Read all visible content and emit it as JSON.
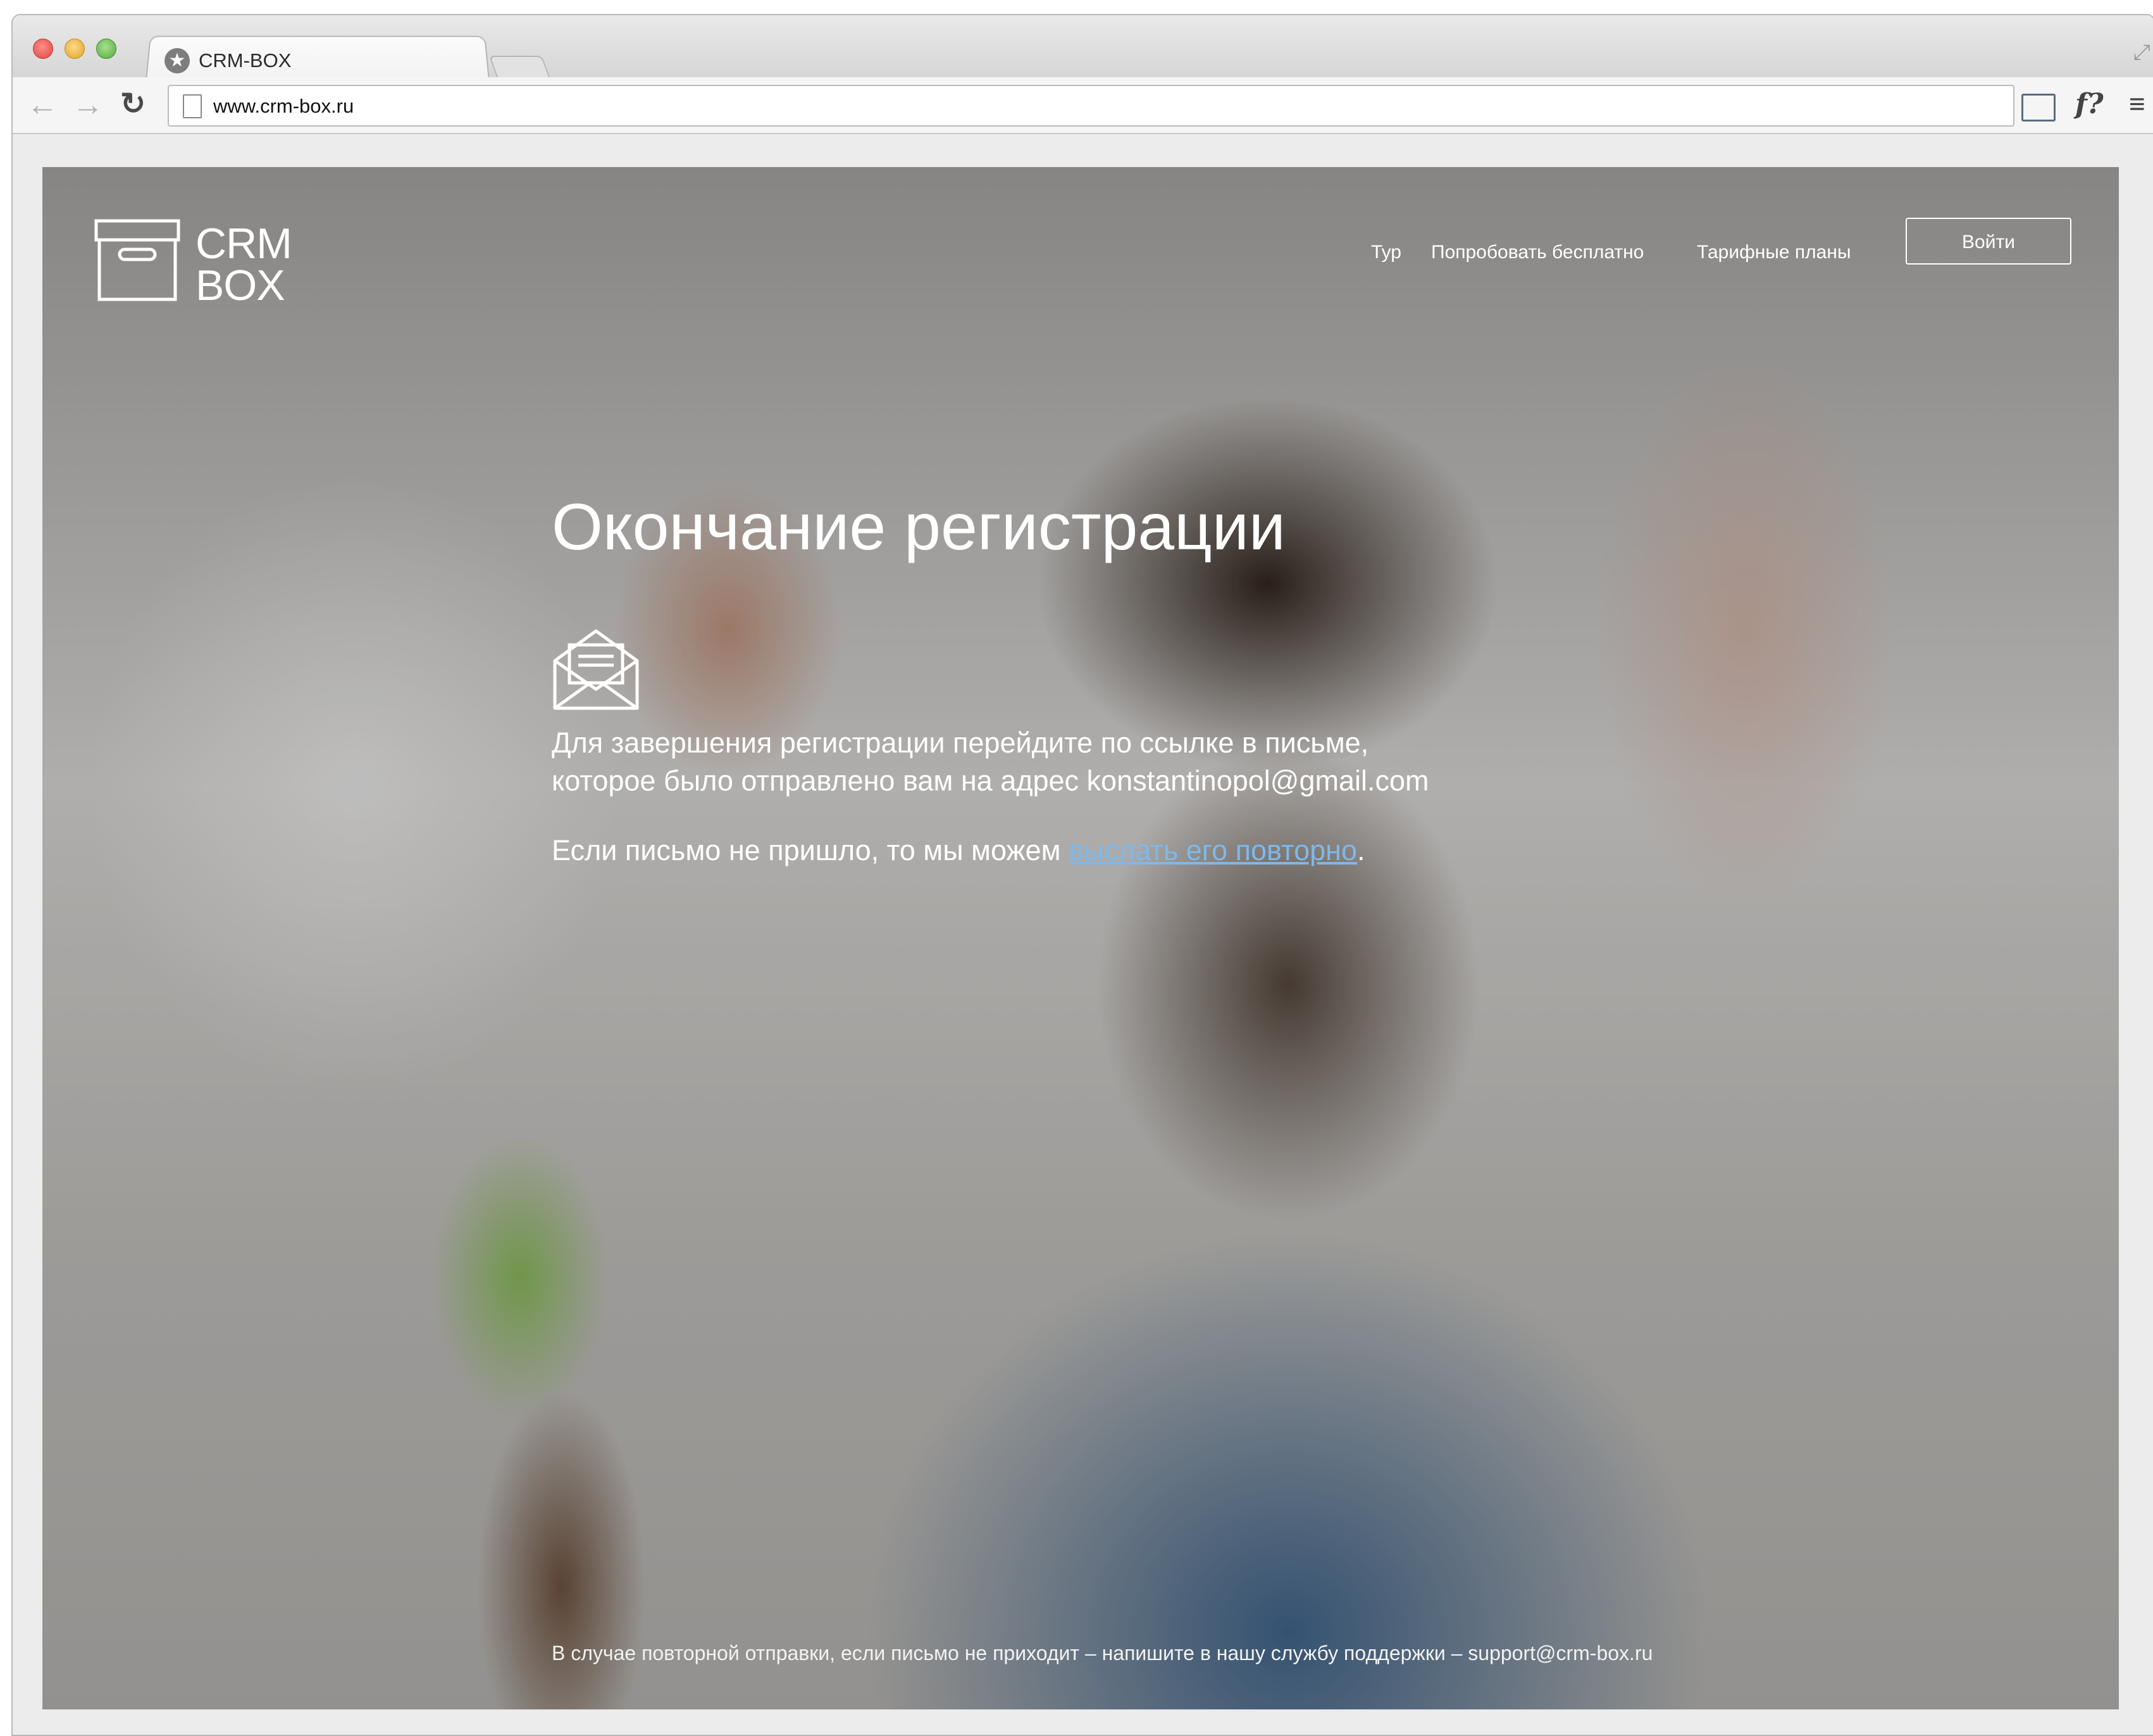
{
  "browser": {
    "tab_title": "CRM-BOX",
    "url": "www.crm-box.ru",
    "toolbar_font_icon": "f?"
  },
  "site": {
    "logo": {
      "line1": "CRM",
      "line2": "BOX"
    },
    "nav": [
      {
        "label": "Тур"
      },
      {
        "label": "Попробовать бесплатно"
      },
      {
        "label": "Тарифные планы"
      }
    ],
    "login_label": "Войти"
  },
  "main": {
    "title": "Окончание регистрации",
    "message_line1": "Для завершения регистрации перейдите по ссылке в письме,",
    "message_line2": "которое было отправлено вам на адрес konstantinopol@gmail.com",
    "resend_prefix": "Если письмо не пришло, то мы можем ",
    "resend_link": "выслать его повторно",
    "resend_suffix": "."
  },
  "footer": {
    "note": "В случае повторной отправки, если письмо не приходит – напишите в нашу службу поддержки – support@crm-box.ru"
  },
  "colors": {
    "link": "#7fb8ea",
    "text": "#ffffff"
  }
}
